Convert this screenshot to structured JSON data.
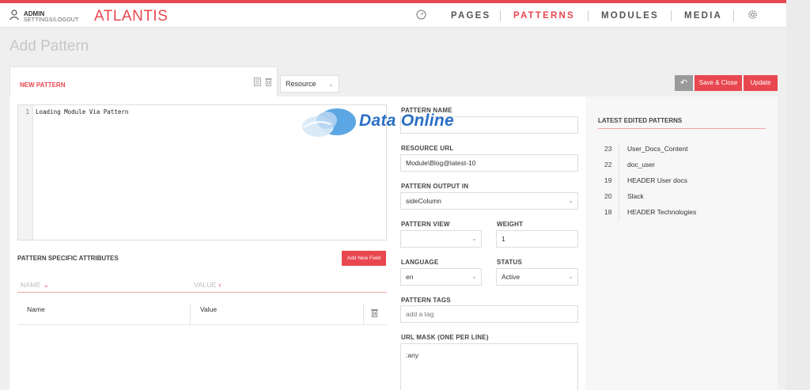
{
  "header": {
    "user": "ADMIN",
    "settings_link": "SETTINGS",
    "link_separator": "/",
    "logout_link": "LOGOUT",
    "brand": "ATLANTIS",
    "nav": [
      {
        "label": "PAGES"
      },
      {
        "label": "PATTERNS",
        "active": true
      },
      {
        "label": "MODULES"
      },
      {
        "label": "MEDIA"
      }
    ],
    "icons": [
      "dashboard-icon",
      "gear-icon",
      "user-icon"
    ]
  },
  "page_title": "Add Pattern",
  "tab": {
    "label": "NEW PATTERN",
    "icons": [
      "document-icon",
      "trash-icon"
    ]
  },
  "type_select": {
    "value": "Resource"
  },
  "actions": {
    "back_icon": "undo-arrow-icon",
    "save_close": "Save & Close",
    "update": "Update"
  },
  "editor": {
    "line_number": "1",
    "code": "Loading Module Via Pattern"
  },
  "attributes": {
    "title": "PATTERN SPECIFIC ATTRIBUTES",
    "add_button": "Add New Field",
    "columns": {
      "name": "NAME",
      "value": "VALUE"
    },
    "row": {
      "name_placeholder": "Name",
      "value_placeholder": "Value"
    }
  },
  "form": {
    "pattern_name": {
      "label": "PATTERN NAME",
      "value": ""
    },
    "resource_url": {
      "label": "RESOURCE URL",
      "value": "Module\\Blog@latest-10"
    },
    "output_in": {
      "label": "PATTERN OUTPUT IN",
      "value": "sideColumn"
    },
    "view": {
      "label": "PATTERN VIEW",
      "value": ""
    },
    "weight": {
      "label": "WEIGHT",
      "value": "1"
    },
    "language": {
      "label": "LANGUAGE",
      "value": "en"
    },
    "status": {
      "label": "STATUS",
      "value": "Active"
    },
    "tags": {
      "label": "PATTERN TAGS",
      "placeholder": "add a tag"
    },
    "url_mask": {
      "label": "URL MASK (ONE PER LINE)",
      "value": ":any"
    }
  },
  "latest": {
    "title": "LATEST EDITED PATTERNS",
    "items": [
      {
        "id": "23",
        "name": "User_Docs_Content"
      },
      {
        "id": "22",
        "name": "doc_user"
      },
      {
        "id": "19",
        "name": "HEADER User docs"
      },
      {
        "id": "20",
        "name": "Slack"
      },
      {
        "id": "18",
        "name": "HEADER Technologies"
      }
    ]
  },
  "watermark": {
    "text": "Data Online"
  },
  "colors": {
    "accent": "#e8474f",
    "watermark": "#2a6fc4"
  }
}
